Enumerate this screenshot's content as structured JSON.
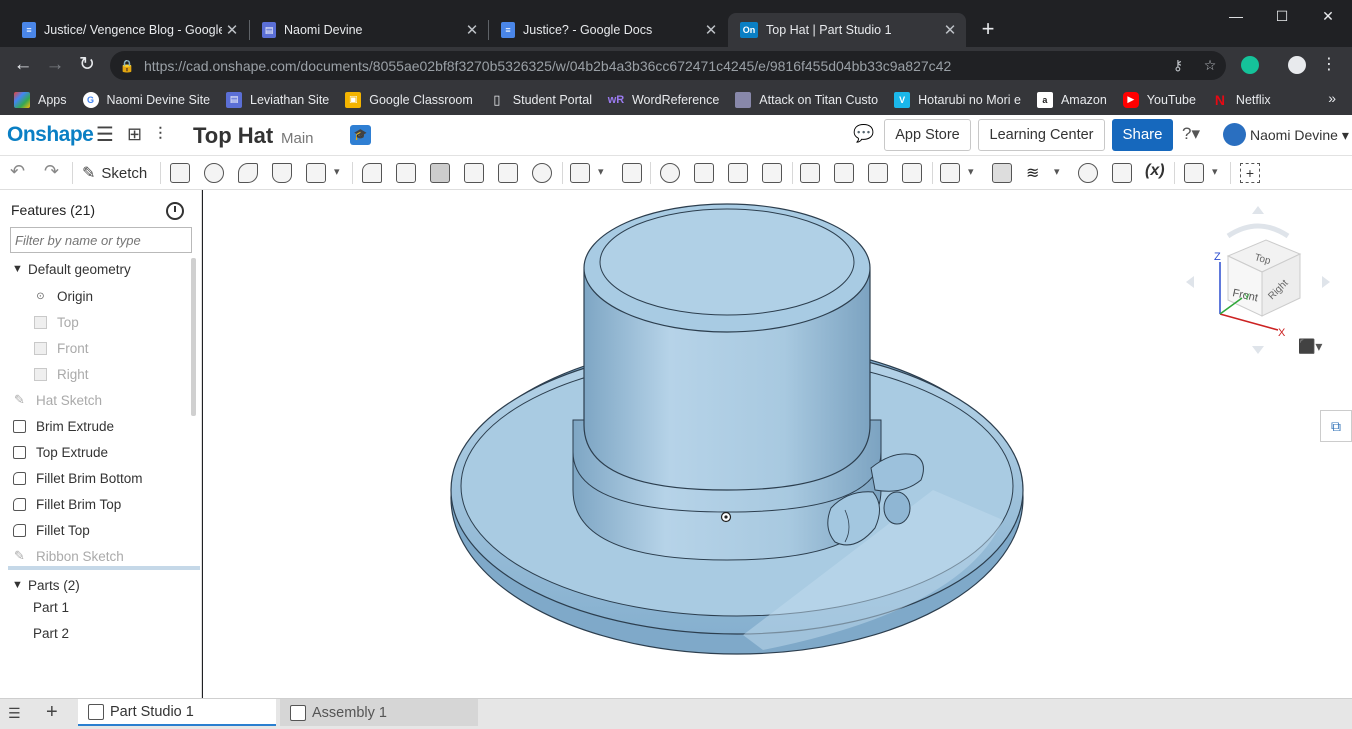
{
  "browser": {
    "tabs": [
      {
        "title": "Justice/ Vengence Blog - Google",
        "icon": "google-docs-icon",
        "color": "#4a86e8"
      },
      {
        "title": "Naomi Devine",
        "icon": "google-sites-icon",
        "color": "#5b6fd6"
      },
      {
        "title": "Justice? - Google Docs",
        "icon": "google-docs-icon",
        "color": "#4a86e8"
      },
      {
        "title": "Top Hat | Part Studio 1",
        "icon": "onshape-icon",
        "color": "#0a7fc4"
      }
    ],
    "active_tab": 3,
    "url": "https://cad.onshape.com/documents/8055ae02bf8f3270b5326325/w/04b2b4a3b36cc672471c4245/e/9816f455d04bb33c9a827c42",
    "bookmarks": [
      {
        "label": "Apps",
        "icon": "apps-grid-icon",
        "color": "#ea4335"
      },
      {
        "label": "Naomi Devine Site",
        "icon": "google-g-icon",
        "color": "#ffffff"
      },
      {
        "label": "Leviathan Site",
        "icon": "google-sites-icon",
        "color": "#5b6fd6"
      },
      {
        "label": "Google Classroom",
        "icon": "classroom-icon",
        "color": "#f4b400"
      },
      {
        "label": "Student Portal",
        "icon": "page-icon",
        "color": "#9aa0a6"
      },
      {
        "label": "WordReference",
        "icon": "wordreference-icon",
        "color": "#7b4fd6"
      },
      {
        "label": "Attack on Titan Custo",
        "icon": "bookmark-image-icon",
        "color": "#8888aa"
      },
      {
        "label": "Hotarubi no Mori e",
        "icon": "vimeo-icon",
        "color": "#1ab7ea"
      },
      {
        "label": "Amazon",
        "icon": "amazon-icon",
        "color": "#222222"
      },
      {
        "label": "YouTube",
        "icon": "youtube-icon",
        "color": "#ff0000"
      },
      {
        "label": "Netflix",
        "icon": "netflix-icon",
        "color": "#e50914"
      }
    ],
    "overflow_label": "»"
  },
  "onshape": {
    "logo": "Onshape",
    "document_title": "Top Hat",
    "branch": "Main",
    "buttons": {
      "app_store": "App Store",
      "learning_center": "Learning Center",
      "share": "Share"
    },
    "user": "Naomi Devine",
    "accent": "#1668bd"
  },
  "toolbar": {
    "sketch_label": "Sketch",
    "variable_label": "(x)"
  },
  "features": {
    "header": "Features (21)",
    "filter_placeholder": "Filter by name or type",
    "default_geometry": "Default geometry",
    "origin": "Origin",
    "planes": [
      "Top",
      "Front",
      "Right"
    ],
    "list": [
      {
        "label": "Hat Sketch",
        "kind": "sketch"
      },
      {
        "label": "Brim Extrude",
        "kind": "extrude"
      },
      {
        "label": "Top Extrude",
        "kind": "extrude"
      },
      {
        "label": "Fillet Brim Bottom",
        "kind": "fillet"
      },
      {
        "label": "Fillet Brim Top",
        "kind": "fillet"
      },
      {
        "label": "Fillet Top",
        "kind": "fillet"
      },
      {
        "label": "Ribbon Sketch",
        "kind": "sketch"
      }
    ],
    "parts_header": "Parts (2)",
    "parts": [
      "Part 1",
      "Part 2"
    ]
  },
  "viewcube": {
    "faces": [
      "Top",
      "Front",
      "Right"
    ],
    "axes": [
      "Z",
      "Y",
      "X"
    ]
  },
  "bottom_tabs": [
    {
      "label": "Part Studio 1",
      "active": true
    },
    {
      "label": "Assembly 1",
      "active": false
    }
  ],
  "model_color": "#9fc4de"
}
